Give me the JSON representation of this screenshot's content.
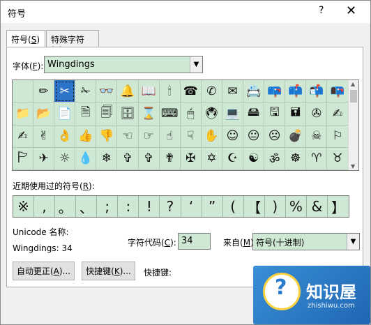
{
  "window": {
    "title": "符号",
    "help": "?",
    "close": "✕"
  },
  "tabs": [
    {
      "label": "符号",
      "mnemonic": "S"
    },
    {
      "label": "特殊字符",
      "mnemonic": "P"
    }
  ],
  "font": {
    "label": "字体",
    "mnemonic": "F",
    "value": "Wingdings"
  },
  "symbol_grid": {
    "selected_index": 2,
    "rows": [
      [
        "",
        "✏",
        "✂",
        "✁",
        "👓",
        "🔔",
        "📖",
        "🕯",
        "☎",
        "✆",
        "✉",
        "📇",
        "📪",
        "📫",
        "📬",
        "📭"
      ],
      [
        "📁",
        "📂",
        "📄",
        "🗎",
        "🗐",
        "🗄",
        "⌛",
        "⌨",
        "🖱",
        "🖲",
        "💻",
        "🖴",
        "🖫",
        "🖬",
        "✇",
        "✍"
      ],
      [
        "✍",
        "✌",
        "👌",
        "👍",
        "👎",
        "☜",
        "☞",
        "☝",
        "☟",
        "✋",
        "☺",
        "😐",
        "☹",
        "💣",
        "☠",
        "⚐"
      ],
      [
        "🏱",
        "✈",
        "☼",
        "💧",
        "❄",
        "✞",
        "✞",
        "✟",
        "✠",
        "✡",
        "☪",
        "☯",
        "ॐ",
        "☸",
        "♈",
        "♉"
      ]
    ]
  },
  "recent": {
    "label": "近期使用过的符号",
    "mnemonic": "R",
    "symbols": [
      "※",
      ",",
      "。",
      "、",
      ";",
      ":",
      "!",
      "?",
      "‘",
      "”",
      "(",
      "【",
      ")",
      "%",
      "&",
      "】"
    ]
  },
  "unicode": {
    "name_label": "Unicode 名称:",
    "name_value": "Wingdings: 34"
  },
  "char_code": {
    "label": "字符代码",
    "mnemonic": "C",
    "value": "34"
  },
  "from": {
    "label": "来自",
    "mnemonic": "M",
    "value": "符号(十进制)"
  },
  "buttons": {
    "autocorrect": {
      "label": "自动更正",
      "mnemonic": "A"
    },
    "shortcut": {
      "label": "快捷键",
      "mnemonic": "K"
    }
  },
  "shortcut_label": "快捷键:",
  "watermark": {
    "brand": "知识屋",
    "url": "zhishiwu.com"
  }
}
